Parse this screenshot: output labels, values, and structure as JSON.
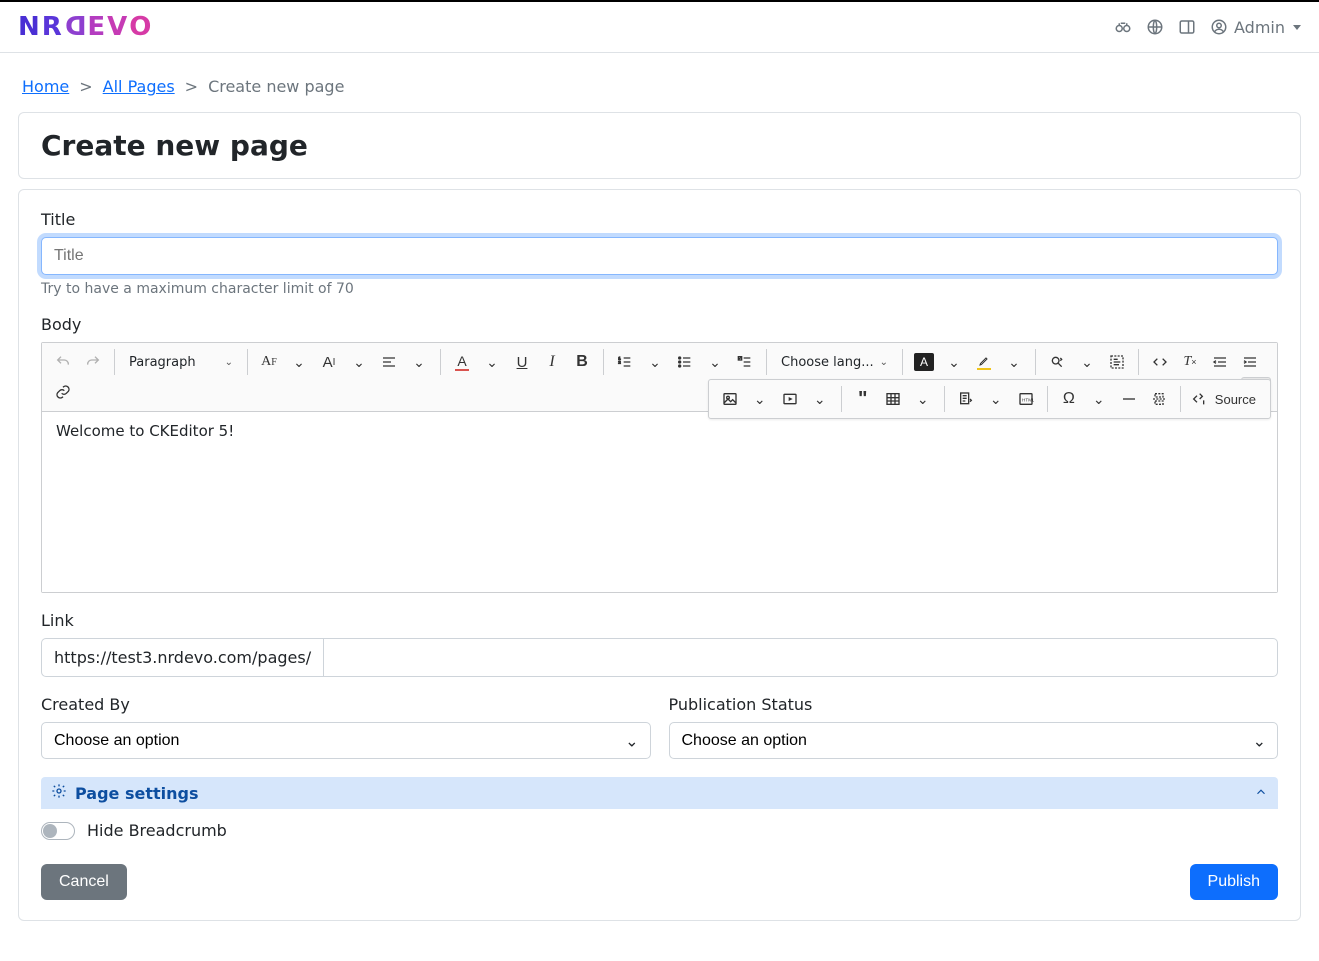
{
  "nav": {
    "user_label": "Admin"
  },
  "breadcrumb": {
    "home": "Home",
    "all_pages": "All Pages",
    "current": "Create new page"
  },
  "page_title": "Create new page",
  "form": {
    "title_label": "Title",
    "title_placeholder": "Title",
    "title_help": "Try to have a maximum character limit of 70",
    "body_label": "Body",
    "link_label": "Link",
    "link_prefix": "https://test3.nrdevo.com/pages/",
    "created_by_label": "Created By",
    "created_by_option": "Choose an option",
    "pub_status_label": "Publication Status",
    "pub_status_option": "Choose an option",
    "page_settings_label": "Page settings",
    "hide_breadcrumb_label": "Hide Breadcrumb"
  },
  "editor": {
    "heading_label": "Paragraph",
    "lang_label": "Choose lang...",
    "source_label": "Source",
    "placeholder": "Welcome to CKEditor 5!"
  },
  "actions": {
    "cancel_label": "Cancel",
    "publish_label": "Publish"
  }
}
